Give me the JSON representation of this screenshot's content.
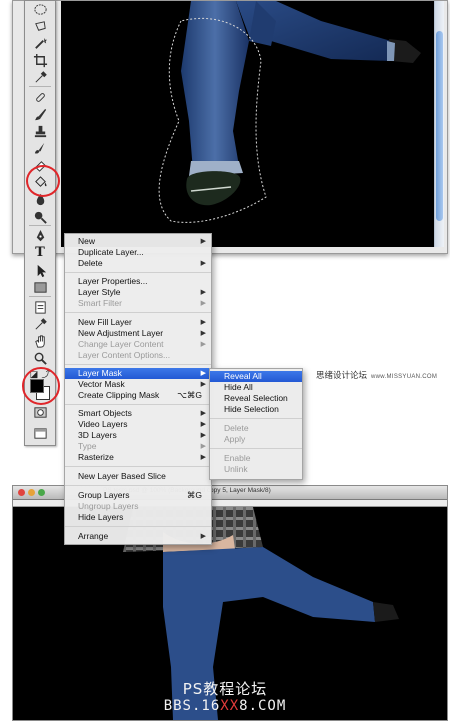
{
  "context_menu": {
    "items": [
      {
        "label": "New",
        "submenu": true,
        "disabled": false
      },
      {
        "label": "Duplicate Layer...",
        "disabled": false
      },
      {
        "label": "Delete",
        "submenu": true,
        "disabled": false
      },
      {
        "label": "Layer Properties...",
        "disabled": false
      },
      {
        "label": "Layer Style",
        "submenu": true,
        "disabled": false
      },
      {
        "label": "Smart Filter",
        "submenu": true,
        "disabled": true
      },
      {
        "label": "New Fill Layer",
        "submenu": true,
        "disabled": false
      },
      {
        "label": "New Adjustment Layer",
        "submenu": true,
        "disabled": false
      },
      {
        "label": "Change Layer Content",
        "submenu": true,
        "disabled": true
      },
      {
        "label": "Layer Content Options...",
        "disabled": true
      },
      {
        "label": "Layer Mask",
        "submenu": true,
        "active": true
      },
      {
        "label": "Vector Mask",
        "submenu": true,
        "disabled": false
      },
      {
        "label": "Create Clipping Mask",
        "shortcut": "⌥⌘G",
        "disabled": false
      },
      {
        "label": "Smart Objects",
        "submenu": true,
        "disabled": false
      },
      {
        "label": "Video Layers",
        "submenu": true,
        "disabled": false
      },
      {
        "label": "3D Layers",
        "submenu": true,
        "disabled": false
      },
      {
        "label": "Type",
        "submenu": true,
        "disabled": true
      },
      {
        "label": "Rasterize",
        "submenu": true,
        "disabled": false
      },
      {
        "label": "New Layer Based Slice",
        "disabled": false
      },
      {
        "label": "Group Layers",
        "shortcut": "⌘G",
        "disabled": false
      },
      {
        "label": "Ungroup Layers",
        "disabled": true
      },
      {
        "label": "Hide Layers",
        "disabled": false
      },
      {
        "label": "Arrange",
        "submenu": true,
        "disabled": false
      }
    ]
  },
  "submenu": {
    "items": [
      {
        "label": "Reveal All",
        "active": true
      },
      {
        "label": "Hide All"
      },
      {
        "label": "Reveal Selection"
      },
      {
        "label": "Hide Selection"
      },
      {
        "label": "Delete",
        "disabled": true
      },
      {
        "label": "Apply",
        "disabled": true
      },
      {
        "label": "Enable",
        "disabled": true
      },
      {
        "label": "Unlink",
        "disabled": true
      }
    ]
  },
  "annotation": {
    "cn": "思绪设计论坛",
    "en": "www.MISSYUAN.COM"
  },
  "bottom_window": {
    "title": "PS tests.psd @ 100% (Background copy 5, Layer Mask/8)"
  },
  "watermark": {
    "cn": "PS教程论坛",
    "url_pre": "BBS.16",
    "url_hl": "XX",
    "url_post": "8.COM"
  },
  "colors": {
    "menu_highlight": "#2359d4",
    "annotation_circle": "#e0262a"
  },
  "icons": [
    "marquee-icon",
    "lasso-icon",
    "magic-wand-icon",
    "crop-icon",
    "eyedropper-icon",
    "healing-brush-icon",
    "brush-icon",
    "clone-stamp-icon",
    "history-brush-icon",
    "eraser-icon",
    "paint-bucket-icon",
    "blur-icon",
    "dodge-icon",
    "pen-icon",
    "type-icon",
    "path-selection-icon",
    "rectangle-icon",
    "notes-icon",
    "eyedropper-2-icon",
    "hand-icon",
    "zoom-icon",
    "swap-colors-icon",
    "default-colors-icon",
    "foreground-color-swatch",
    "quick-mask-icon",
    "screen-mode-icon"
  ]
}
